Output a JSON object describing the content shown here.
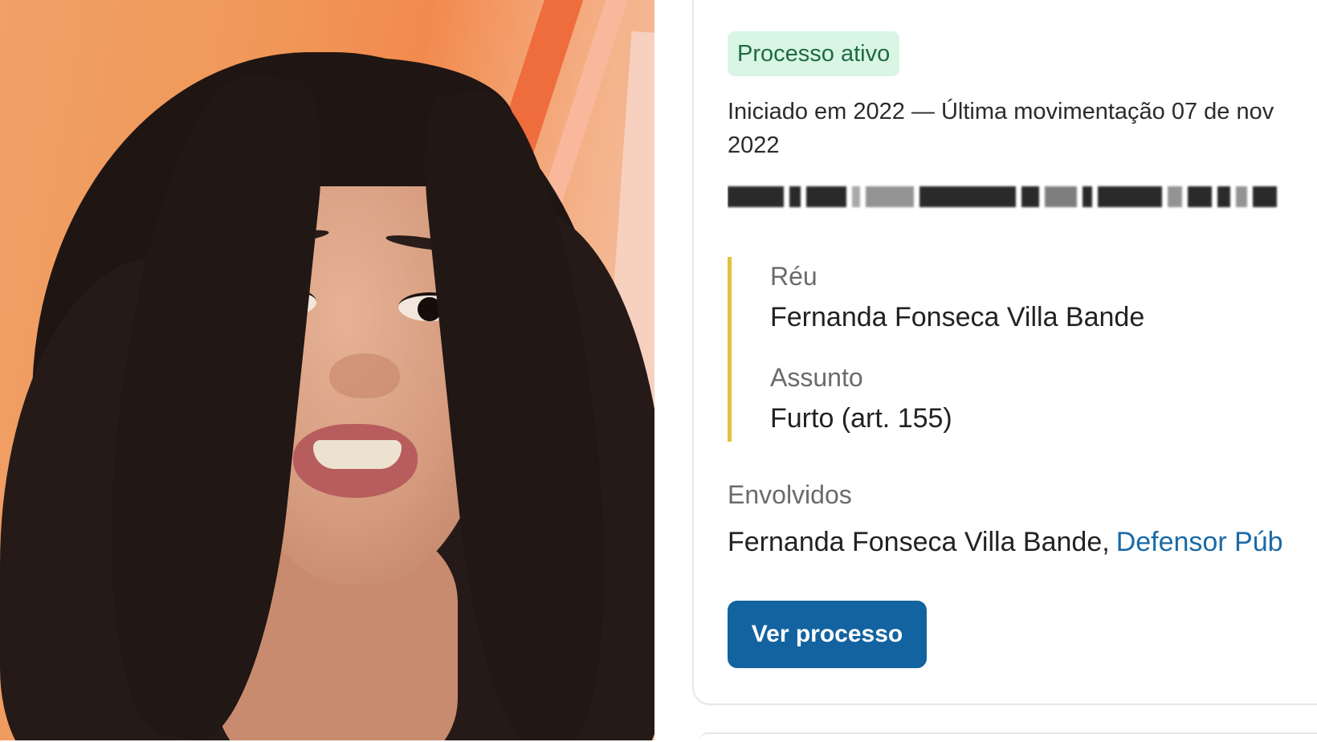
{
  "photo": {
    "description_icon": "person-photo",
    "colors": {
      "background": "#f0984f",
      "hair": "#1f1614",
      "skin": "#d49a7d"
    }
  },
  "card": {
    "status_badge": "Processo ativo",
    "started_text": "Iniciado em 2022 — Última movimentação 07 de nov 2022",
    "fields": {
      "reu_label": "Réu",
      "reu_value": "Fernanda Fonseca Villa Bande",
      "assunto_label": "Assunto",
      "assunto_value": "Furto (art. 155)"
    },
    "involved_label": "Envolvidos",
    "involved_name": "Fernanda Fonseca Villa Bande,",
    "involved_link": "Defensor Púb",
    "view_button": "Ver processo",
    "colors": {
      "badge_bg": "#d9f5e4",
      "badge_text": "#1d6b43",
      "accent_bar": "#e2c23c",
      "link": "#1a6aa8",
      "button": "#12639f"
    }
  }
}
